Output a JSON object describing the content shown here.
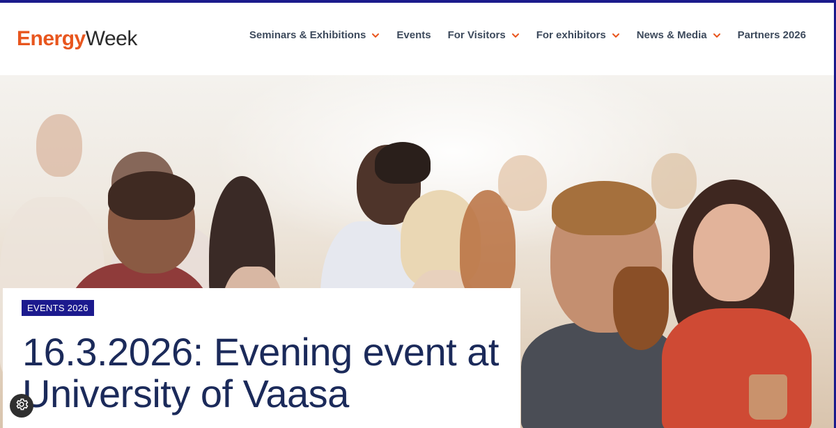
{
  "header": {
    "logo": {
      "part1": "Energy",
      "part2": "Week"
    },
    "nav": [
      {
        "label": "Seminars & Exhibitions",
        "has_dropdown": true
      },
      {
        "label": "Events",
        "has_dropdown": false
      },
      {
        "label": "For Visitors",
        "has_dropdown": true
      },
      {
        "label": "For exhibitors",
        "has_dropdown": true
      },
      {
        "label": "News & Media",
        "has_dropdown": true
      },
      {
        "label": "Partners 2026",
        "has_dropdown": false
      }
    ]
  },
  "hero": {
    "badge": "EVENTS 2026",
    "title": "16.3.2026: Evening event at University of Vaasa"
  },
  "colors": {
    "brand_orange": "#e8561e",
    "brand_navy": "#1c1a8e",
    "title_navy": "#1b2a5a",
    "nav_text": "#3d4a5c"
  },
  "icons": {
    "dropdown": "chevron-down-icon",
    "settings": "gear-icon"
  }
}
